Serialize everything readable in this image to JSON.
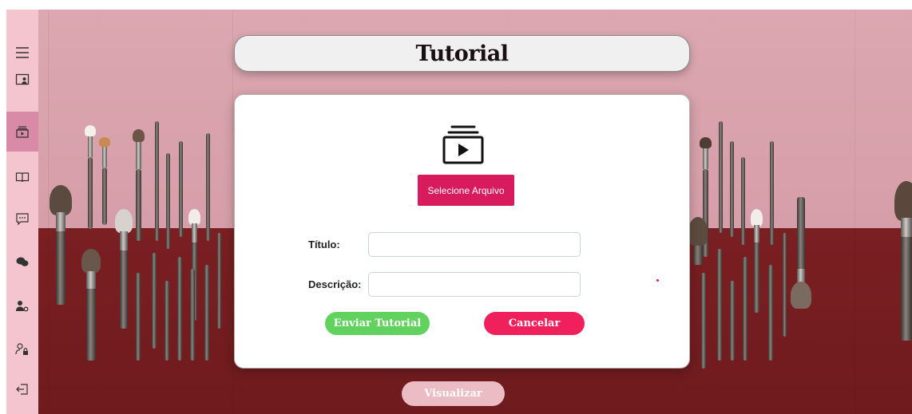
{
  "sidebar": {
    "items": [
      {
        "icon": "menu-icon"
      },
      {
        "icon": "profile-card-icon"
      },
      {
        "icon": "video-tutorial-icon",
        "active": true
      },
      {
        "icon": "book-icon"
      },
      {
        "icon": "chat-icon"
      },
      {
        "icon": "community-icon"
      },
      {
        "icon": "user-settings-icon"
      },
      {
        "icon": "user-lock-icon"
      },
      {
        "icon": "logout-icon"
      }
    ]
  },
  "header": {
    "title": "Tutorial"
  },
  "form": {
    "select_file_label": "Selecione Arquivo",
    "title_label": "Título:",
    "description_label": "Descrição:",
    "title_value": "",
    "description_value": "",
    "send_label": "Enviar Tutorial",
    "cancel_label": "Cancelar"
  },
  "view_label": "Visualizar",
  "colors": {
    "accent": "#d81b5c",
    "send": "#62d25f",
    "cancel": "#f0205c",
    "sidebar": "#f4c4cf",
    "sidebar_active": "#d98aa7"
  }
}
